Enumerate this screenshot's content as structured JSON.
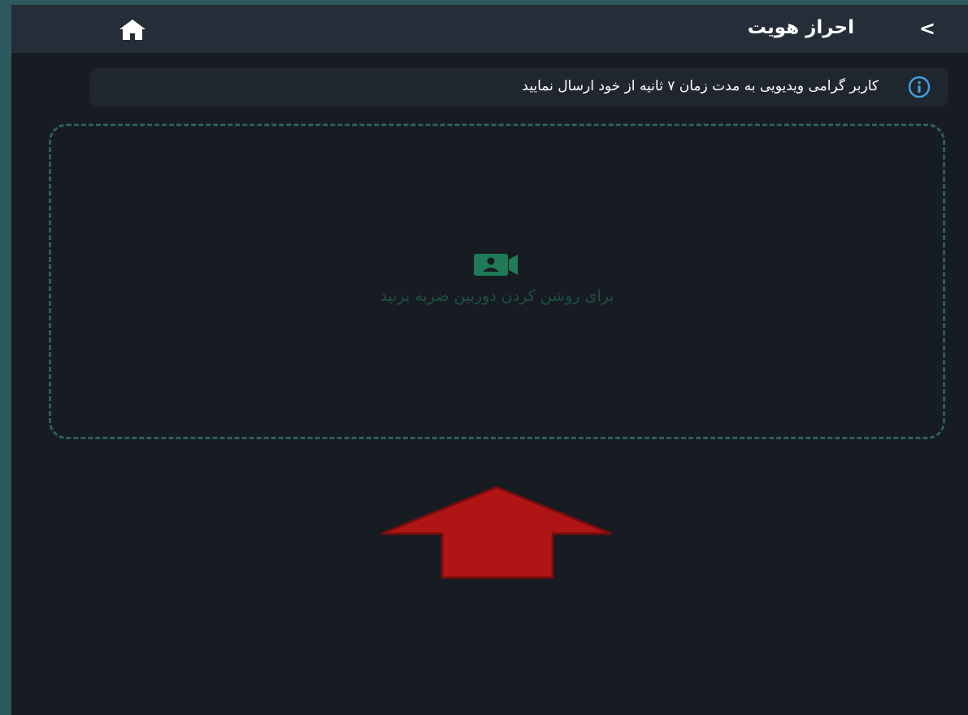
{
  "header": {
    "title": "احراز هویت",
    "back_icon": "chevron-left-icon",
    "home_icon": "home-icon"
  },
  "info": {
    "icon": "info-icon",
    "text": "کاربر گرامی ویدیویی به مدت زمان ۷ ثانیه از خود ارسال نمایید"
  },
  "camera": {
    "icon": "video-camera-icon",
    "prompt": "برای روشن کردن دوربین ضربه بزنید"
  },
  "colors": {
    "background": "#171b22",
    "header": "#252e38",
    "accent_green": "#1f7a57",
    "info_blue": "#3ea0e0",
    "arrow_red": "#b01515"
  }
}
